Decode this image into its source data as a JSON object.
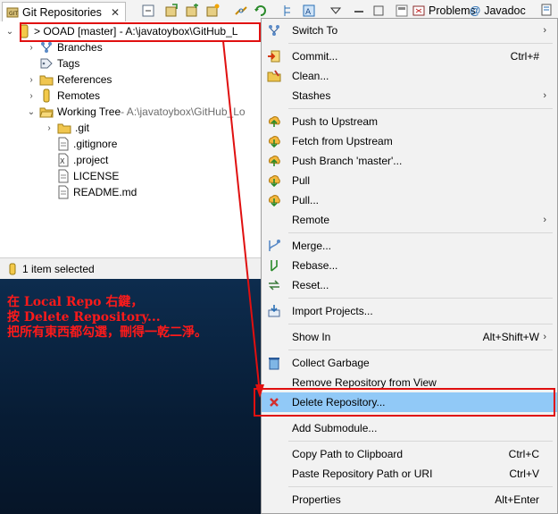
{
  "view": {
    "tab_label": "Git Repositories",
    "close_glyph": "✕",
    "other_tabs": [
      "Problems",
      "Javadoc"
    ]
  },
  "tree": {
    "repo": "> OOAD [master] - A:\\javatoybox\\GitHub_L",
    "items": [
      {
        "label": "Branches"
      },
      {
        "label": "Tags"
      },
      {
        "label": "References"
      },
      {
        "label": "Remotes"
      }
    ],
    "working_tree_label": "Working Tree",
    "working_tree_path": " - A:\\javatoybox\\GitHub_Lo",
    "files": [
      ".git",
      ".gitignore",
      ".project",
      "LICENSE",
      "README.md"
    ]
  },
  "status": {
    "text": "1 item selected"
  },
  "annotation": {
    "line1": "在 Local Repo 右鍵，",
    "line2": "按 Delete Repository...",
    "line3": "把所有東西都勾選，刪得一乾二淨。"
  },
  "menu": {
    "items": [
      {
        "label": "Switch To",
        "shortcut": "",
        "submenu": true,
        "icon": "switch-icon"
      },
      {
        "label": "Commit...",
        "shortcut": "Ctrl+#",
        "submenu": false,
        "icon": "commit-icon"
      },
      {
        "label": "Clean...",
        "shortcut": "",
        "submenu": false,
        "icon": "clean-icon"
      },
      {
        "label": "Stashes",
        "shortcut": "",
        "submenu": true,
        "icon": ""
      },
      {
        "label": "Push to Upstream",
        "shortcut": "",
        "submenu": false,
        "icon": "push-icon"
      },
      {
        "label": "Fetch from Upstream",
        "shortcut": "",
        "submenu": false,
        "icon": "fetch-icon"
      },
      {
        "label": "Push Branch 'master'...",
        "shortcut": "",
        "submenu": false,
        "icon": "push-branch-icon"
      },
      {
        "label": "Pull",
        "shortcut": "",
        "submenu": false,
        "icon": "pull-icon"
      },
      {
        "label": "Pull...",
        "shortcut": "",
        "submenu": false,
        "icon": "pull-dialog-icon"
      },
      {
        "label": "Remote",
        "shortcut": "",
        "submenu": true,
        "icon": ""
      },
      {
        "label": "Merge...",
        "shortcut": "",
        "submenu": false,
        "icon": "merge-icon"
      },
      {
        "label": "Rebase...",
        "shortcut": "",
        "submenu": false,
        "icon": "rebase-icon"
      },
      {
        "label": "Reset...",
        "shortcut": "",
        "submenu": false,
        "icon": "reset-icon"
      },
      {
        "label": "Import Projects...",
        "shortcut": "",
        "submenu": false,
        "icon": "import-icon"
      },
      {
        "label": "Show In",
        "shortcut": "Alt+Shift+W",
        "submenu": true,
        "icon": ""
      },
      {
        "label": "Collect Garbage",
        "shortcut": "",
        "submenu": false,
        "icon": "trash-icon"
      },
      {
        "label": "Remove Repository from View",
        "shortcut": "",
        "submenu": false,
        "icon": ""
      },
      {
        "label": "Delete Repository...",
        "shortcut": "",
        "submenu": false,
        "icon": "delete-icon"
      },
      {
        "label": "Add Submodule...",
        "shortcut": "",
        "submenu": false,
        "icon": ""
      },
      {
        "label": "Copy Path to Clipboard",
        "shortcut": "Ctrl+C",
        "submenu": false,
        "icon": ""
      },
      {
        "label": "Paste Repository Path or URI",
        "shortcut": "Ctrl+V",
        "submenu": false,
        "icon": ""
      },
      {
        "label": "Properties",
        "shortcut": "Alt+Enter",
        "submenu": false,
        "icon": ""
      }
    ],
    "arrow_glyph": "›",
    "highlighted_item": "Delete Repository..."
  },
  "colors": {
    "annotation": "#ff1a1a",
    "highlight": "#91c9f7",
    "desktop": "#0d2c4e"
  }
}
